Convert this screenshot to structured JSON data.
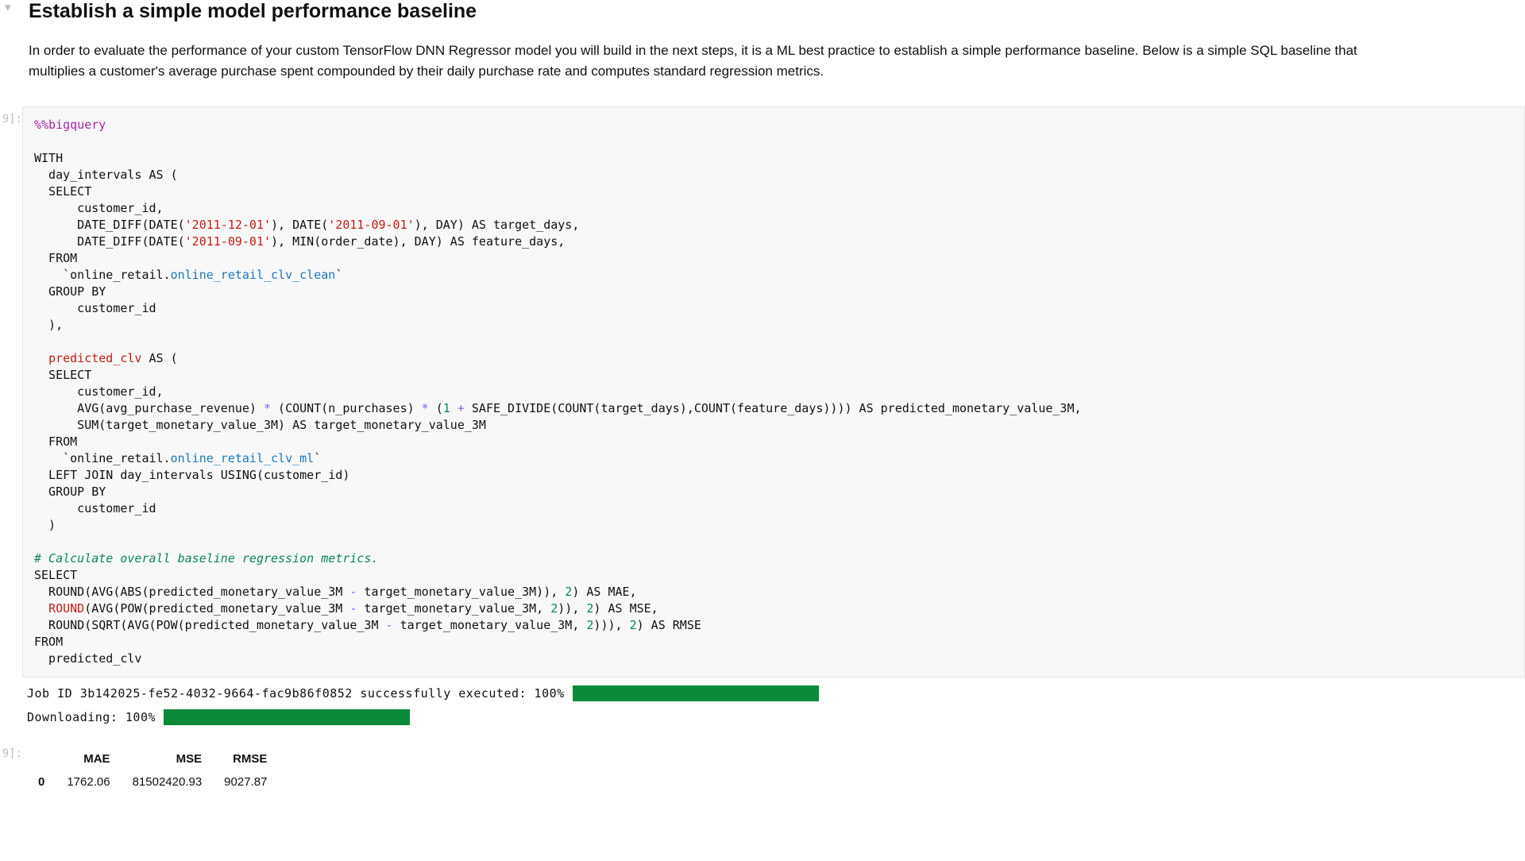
{
  "markdown": {
    "heading": "Establish a simple model performance baseline",
    "paragraph": "In order to evaluate the performance of your custom TensorFlow DNN Regressor model you will build in the next steps, it is a ML best practice to establish a simple performance baseline. Below is a simple SQL baseline that multiplies a customer's average purchase spent compounded by their daily purchase rate and computes standard regression metrics."
  },
  "cell_prompt_in": "9]:",
  "cell_prompt_out": "9]:",
  "code": {
    "magic": "%%bigquery",
    "l01": "",
    "l02": "WITH",
    "l03": "  day_intervals AS (",
    "l04": "  SELECT",
    "l05": "      customer_id,",
    "l06a": "      DATE_DIFF(DATE(",
    "l06s1": "'2011-12-01'",
    "l06b": "), DATE(",
    "l06s2": "'2011-09-01'",
    "l06c": "), DAY) AS target_days,",
    "l07a": "      DATE_DIFF(DATE(",
    "l07s1": "'2011-09-01'",
    "l07b": "), MIN(order_date), DAY) AS feature_days,",
    "l08": "  FROM",
    "l09a": "    `online_retail.",
    "l09t": "online_retail_clv_clean",
    "l09b": "`",
    "l10": "  GROUP BY",
    "l11": "      customer_id",
    "l12": "  ),",
    "l13": "",
    "l14a": "  ",
    "l14k": "predicted_clv",
    "l14b": " AS (",
    "l15": "  SELECT",
    "l16": "      customer_id,",
    "l17a": "      AVG(avg_purchase_revenue) ",
    "l17op1": "*",
    "l17b": " (COUNT(n_purchases) ",
    "l17op2": "*",
    "l17c": " (",
    "l17n1": "1",
    "l17d": " ",
    "l17op3": "+",
    "l17e": " SAFE_DIVIDE(COUNT(target_days),COUNT(feature_days)))) AS predicted_monetary_value_3M,",
    "l18": "      SUM(target_monetary_value_3M) AS target_monetary_value_3M",
    "l19": "  FROM",
    "l20a": "    `online_retail.",
    "l20t": "online_retail_clv_ml",
    "l20b": "`",
    "l21": "  LEFT JOIN day_intervals USING(customer_id)",
    "l22": "  GROUP BY",
    "l23": "      customer_id",
    "l24": "  )",
    "l25": "",
    "l26": "# Calculate overall baseline regression metrics.",
    "l27": "SELECT",
    "l28a": "  ROUND(AVG(ABS(predicted_monetary_value_3M ",
    "l28op": "-",
    "l28b": " target_monetary_value_3M)), ",
    "l28n": "2",
    "l28c": ") AS MAE,",
    "l29a": "  ",
    "l29k": "ROUND",
    "l29b": "(AVG(POW(predicted_monetary_value_3M ",
    "l29op": "-",
    "l29c": " target_monetary_value_3M, ",
    "l29n1": "2",
    "l29d": ")), ",
    "l29n2": "2",
    "l29e": ") AS MSE,",
    "l30a": "  ROUND(SQRT(AVG(POW(predicted_monetary_value_3M ",
    "l30op": "-",
    "l30b": " target_monetary_value_3M, ",
    "l30n1": "2",
    "l30c": "))), ",
    "l30n2": "2",
    "l30d": ") AS RMSE",
    "l31": "FROM",
    "l32": "  predicted_clv"
  },
  "output": {
    "job_line": "Job ID 3b142025-fe52-4032-9664-fac9b86f0852 successfully executed: 100%",
    "download_line": "Downloading: 100%"
  },
  "result_table": {
    "headers": [
      "",
      "MAE",
      "MSE",
      "RMSE"
    ],
    "rows": [
      {
        "idx": "0",
        "mae": "1762.06",
        "mse": "81502420.93",
        "rmse": "9027.87"
      }
    ]
  }
}
